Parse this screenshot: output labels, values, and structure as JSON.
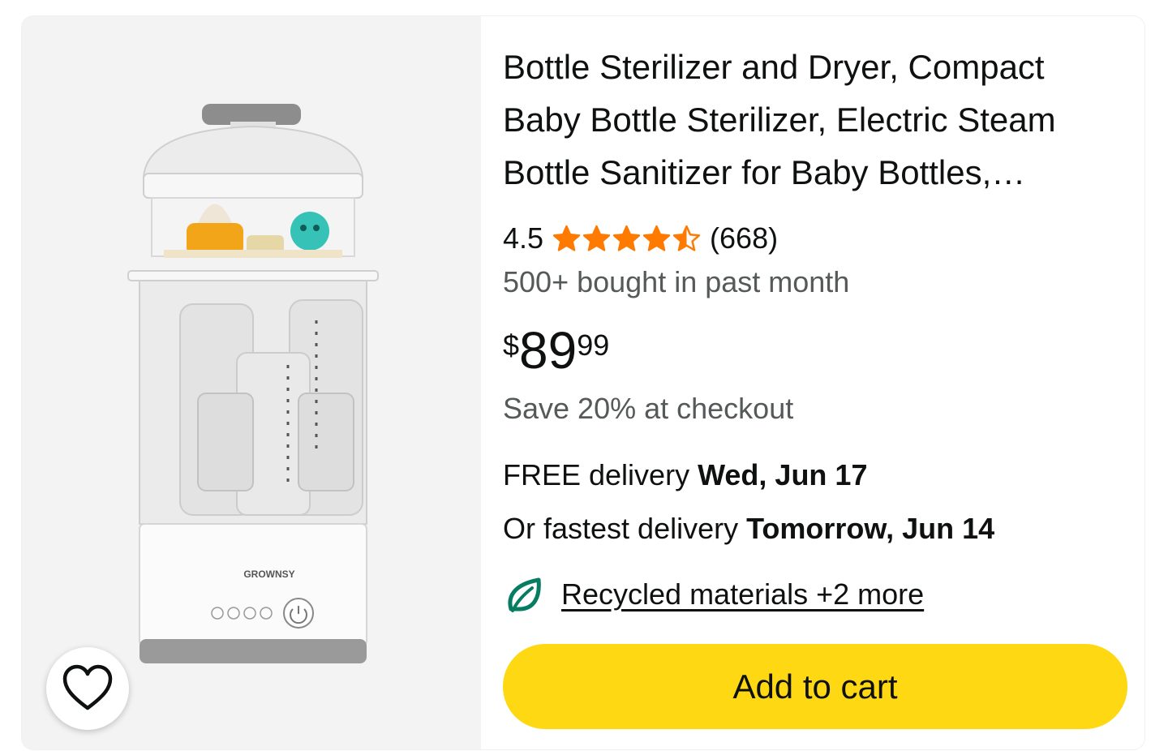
{
  "product": {
    "title": "Bottle Sterilizer and Dryer, Compact Baby Bottle Sterilizer, Electric Steam Bottle Sanitizer for Baby Bottles, Pacifiers, Breast Pump Parts",
    "image_alt": "Bottle sterilizer and dryer",
    "brand_logo_text": "GROWNSY",
    "rating": "4.5",
    "rating_value": 4.5,
    "rating_max": 5,
    "review_count": "(668)",
    "bought_text": "500+ bought in past month",
    "price": {
      "currency": "$",
      "whole": "89",
      "fraction": "99"
    },
    "save_text": "Save 20% at checkout",
    "delivery": {
      "label": "FREE delivery ",
      "date": "Wed, Jun 17"
    },
    "fastest": {
      "label": "Or fastest delivery ",
      "date": "Tomorrow, Jun 14"
    },
    "sustainability_link": "Recycled materials +2 more"
  },
  "actions": {
    "add_to_cart": "Add to cart"
  },
  "icons": {
    "wishlist": "heart-icon",
    "star": "star-icon",
    "leaf": "leaf-icon"
  },
  "colors": {
    "star": "#ff7a00",
    "button": "#ffd814",
    "leaf": "#067d62",
    "image_bg": "#f3f3f3",
    "secondary_text": "#565959"
  }
}
